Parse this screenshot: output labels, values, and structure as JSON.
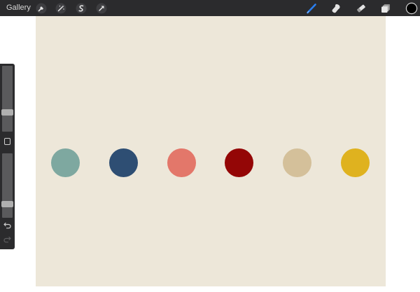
{
  "topbar": {
    "gallery_label": "Gallery",
    "left_tools": [
      "wrench-icon",
      "magic-wand-icon",
      "selection-icon",
      "transform-arrow-icon"
    ],
    "right_tools": [
      "brush-icon",
      "smudge-icon",
      "eraser-icon",
      "layers-icon",
      "color-swatch"
    ],
    "active_tool": "brush",
    "active_color": "#000000",
    "accent_color": "#2a7ff0"
  },
  "canvas": {
    "background": "#ede7d9",
    "swatches": [
      {
        "color": "#7ea8a0"
      },
      {
        "color": "#2e4e73"
      },
      {
        "color": "#e3776a"
      },
      {
        "color": "#940606"
      },
      {
        "color": "#d4c09a"
      },
      {
        "color": "#dfb21f"
      }
    ]
  },
  "sidebar": {
    "brush_size_level": 0.27,
    "opacity_level": 0.18,
    "controls": [
      "brush-size-slider",
      "modify-button",
      "opacity-slider",
      "undo-icon",
      "redo-icon"
    ]
  }
}
